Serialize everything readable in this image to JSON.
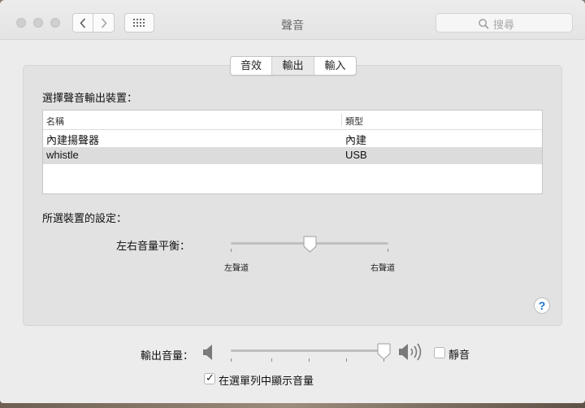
{
  "window": {
    "title": "聲音"
  },
  "search": {
    "placeholder": "搜尋"
  },
  "tabs": [
    {
      "label": "音效",
      "active": false
    },
    {
      "label": "輸出",
      "active": true
    },
    {
      "label": "輸入",
      "active": false
    }
  ],
  "output": {
    "heading": "選擇聲音輸出裝置：",
    "columns": [
      "名稱",
      "類型"
    ],
    "devices": [
      {
        "name": "內建揚聲器",
        "type": "內建",
        "selected": false
      },
      {
        "name": "whistle",
        "type": "USB",
        "selected": true
      }
    ]
  },
  "settings": {
    "heading": "所選裝置的設定：",
    "balance_label": "左右音量平衡：",
    "balance_value": 0.5,
    "left_label": "左聲道",
    "right_label": "右聲道"
  },
  "help": {
    "label": "?"
  },
  "volume": {
    "label": "輸出音量：",
    "value": 1.0,
    "mute_label": "靜音",
    "mute_checked": false,
    "show_in_menubar_label": "在選單列中顯示音量",
    "show_in_menubar_checked": true
  },
  "colors": {
    "selected_row": "#dcdcdc",
    "help_accent": "#1d6fd8"
  }
}
